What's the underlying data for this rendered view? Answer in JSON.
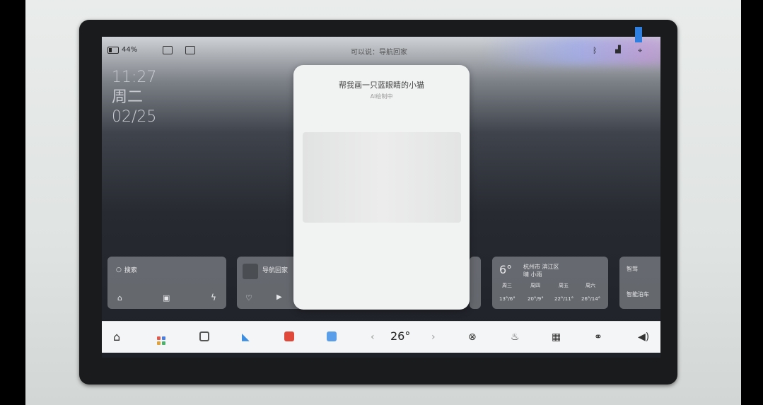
{
  "status_bar": {
    "battery": "44%",
    "center_text": "可以说：导航回家"
  },
  "clock": {
    "time": "11:27",
    "weekday": "周二",
    "date": "02/25"
  },
  "dialog": {
    "title": "帮我画一只蓝眼睛的小猫",
    "subtitle": "AI绘制中"
  },
  "cards": {
    "search": {
      "label": "搜索"
    },
    "music": {
      "title": "导航回家"
    },
    "weather": {
      "temp": "6°",
      "location": "杭州市 滨江区",
      "condition": "晴 小雨",
      "forecast": [
        {
          "day": "周三",
          "range": "13°/6°"
        },
        {
          "day": "周四",
          "range": "20°/9°"
        },
        {
          "day": "周五",
          "range": "22°/11°"
        },
        {
          "day": "周六",
          "range": "26°/14°"
        }
      ]
    },
    "extra": {
      "title": "智驾",
      "button": "智能泊车"
    }
  },
  "dock": {
    "temperature": "26°"
  }
}
